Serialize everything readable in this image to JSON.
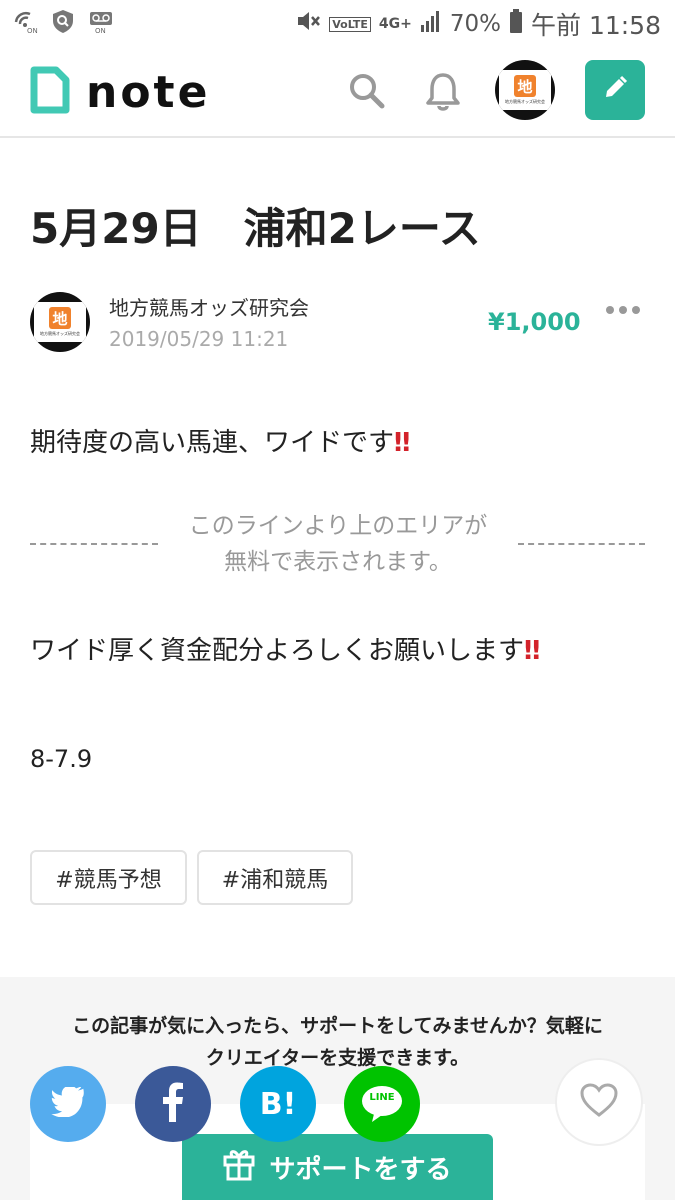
{
  "status_bar": {
    "battery": "70%",
    "time": "午前 11:58",
    "network": "4G+",
    "volte": "VoLTE",
    "on_label": "ON"
  },
  "header": {
    "logo_text": "note"
  },
  "avatar": {
    "char": "地",
    "caption": "地方競馬オッズ研究会"
  },
  "article": {
    "title": "5月29日　浦和2レース",
    "author": "地方競馬オッズ研究会",
    "date": "2019/05/29 11:21",
    "price": "¥1,000",
    "line1": "期待度の高い馬連、ワイドです",
    "exclaim": "‼",
    "paywall_line1": "このラインより上のエリアが",
    "paywall_line2": "無料で表示されます。",
    "line2": "ワイド厚く資金配分よろしくお願いします",
    "line3": "8-7.9",
    "tags": [
      "#競馬予想",
      "#浦和競馬"
    ]
  },
  "support": {
    "text_line1": "この記事が気に入ったら、サポートをしてみませんか？気軽に",
    "text_line2": "クリエイターを支援できます。",
    "button_label": "サポートをする",
    "hatena_label": "B!",
    "line_label": "LINE"
  },
  "colors": {
    "accent": "#2bb399",
    "twitter": "#55acee",
    "facebook": "#3b5998",
    "hatena": "#00a4de",
    "line": "#00c300",
    "exclaim": "#d3222a"
  }
}
